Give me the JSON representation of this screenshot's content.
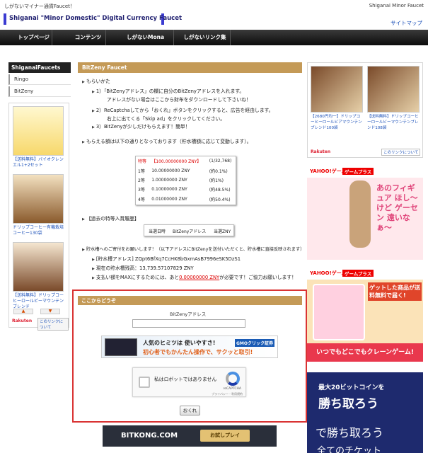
{
  "topbar": {
    "left_text": "しがないマイナー通貨Faucet！",
    "right_text": "Shiganai Minor Faucet"
  },
  "header": {
    "logo_text": "Shiganai \"Minor Domestic\" Digital Currency Faucet",
    "sitemap": "サイトマップ"
  },
  "nav": {
    "items": [
      "トップページ",
      "コンテンツ",
      "しがないMona Faucet",
      "しがないリンク集"
    ]
  },
  "sidebar": {
    "title": "ShiganaiFaucets",
    "items": [
      "Ringo",
      "BitZeny"
    ],
    "ad": {
      "products": [
        "【送料無料】バイオクレンエル1+2セット",
        "ドリップコーヒー有機栽培コーヒー130袋",
        "【送料無料】ドリップコーヒーロールビーマウンテンブレンド"
      ],
      "brand": "Rakuten",
      "more": "このリンクについて",
      "prev": "▲",
      "next": "▼"
    }
  },
  "main": {
    "title": "BitZeny Faucet",
    "intro": "もらいかた",
    "steps": [
      "1）「BitZenyアドレス」の欄に自分のBitZenyアドレスを入れます。",
      "アドレスがない場合はここから財布をダウンロードして下さいね！",
      "2）ReCaptchaしてから「おくれ」ボタンをクリックすると、広告を経由します。",
      "右上に出てくる「Skip ad」をクリックしてください。",
      "3）BitZenyが少しだけもらえます！簡単！"
    ],
    "rates_intro": "もらえる額は以下の通りとなっております（貯水槽額に応じて変動します）。",
    "rates": [
      {
        "rank": "特等",
        "amount": "【100.00000000 ZNY】",
        "prob": "(1/32,768)"
      },
      {
        "rank": "1等",
        "amount": "10.00000000 ZNY",
        "prob": "(約0.1%)"
      },
      {
        "rank": "2等",
        "amount": "1.00000000 ZNY",
        "prob": "(約1%)"
      },
      {
        "rank": "3等",
        "amount": "0.10000000 ZNY",
        "prob": "(約48.5%)"
      },
      {
        "rank": "4等",
        "amount": "0.01000000 ZNY",
        "prob": "(約50.4%)"
      }
    ],
    "history_title": "【過去の特等入賞履歴】",
    "history_headers": [
      "当選日時",
      "BitZenyアドレス",
      "当選ZNY"
    ],
    "donate": "貯水槽へのご寄付をお願いします！（以下アドレスにBitZenyを送付いただくと、貯水槽に直接反映されます）",
    "pool_address_line": "[貯水槽アドレス] ZQpt6BfXq7CcHK8bGxmAsB7996eSK5DzS1",
    "pool_amount_line": "現在の貯水槽残高：13,739.57107829 ZNY",
    "max_pay_prefix": "支払い額をMAXにするためには、あと",
    "max_pay_amount": "0.00000000 ZNY",
    "max_pay_suffix": "が必要です！ご協力お願いします！"
  },
  "form": {
    "title": "ここからどうぞ",
    "address_label": "BitZenyアドレス",
    "address_value": "",
    "gmo_text1": "人気のヒミツは 使いやすさ!",
    "gmo_text2": "初心者でもかんたん操作で、サクッと取引!",
    "gmo_brand": "GMOクリック証券",
    "captcha_label": "私はロボットではありません",
    "captcha_brand": "reCAPTCHA",
    "captcha_links": "プライバシー - 利用規約",
    "submit": "おくれ"
  },
  "bitkong": {
    "name": "BITKONG.COM",
    "cta": "お試しプレイ"
  },
  "right": {
    "ad1": {
      "products": [
        "【2680円均一】ドリップコーヒーロールビアマウンテンブレンド100袋",
        "【送料無料】ドリップコーヒーロールビーマウンテンブレンド108袋"
      ],
      "more": "このリンクについて",
      "brand": "Rakuten"
    },
    "ad2": {
      "yahoo": "YAHOO!ゲーム",
      "game": "ゲームプラス",
      "copy": "あのフィギュア ほし〜けど ゲーセン 遠いなぁ〜"
    },
    "ad3": {
      "yahoo": "YAHOO!ゲーム",
      "game": "ゲームプラス",
      "copy": "ゲットした商品が送料無料で届く!",
      "bottom": "いつでもどこでもクレーンゲーム!"
    },
    "ad4": {
      "top": "最大20ビットコインを",
      "mid": "勝ち取ろう",
      "sub": "で勝ち取ろう",
      "bottom": "全てのチケット"
    }
  }
}
